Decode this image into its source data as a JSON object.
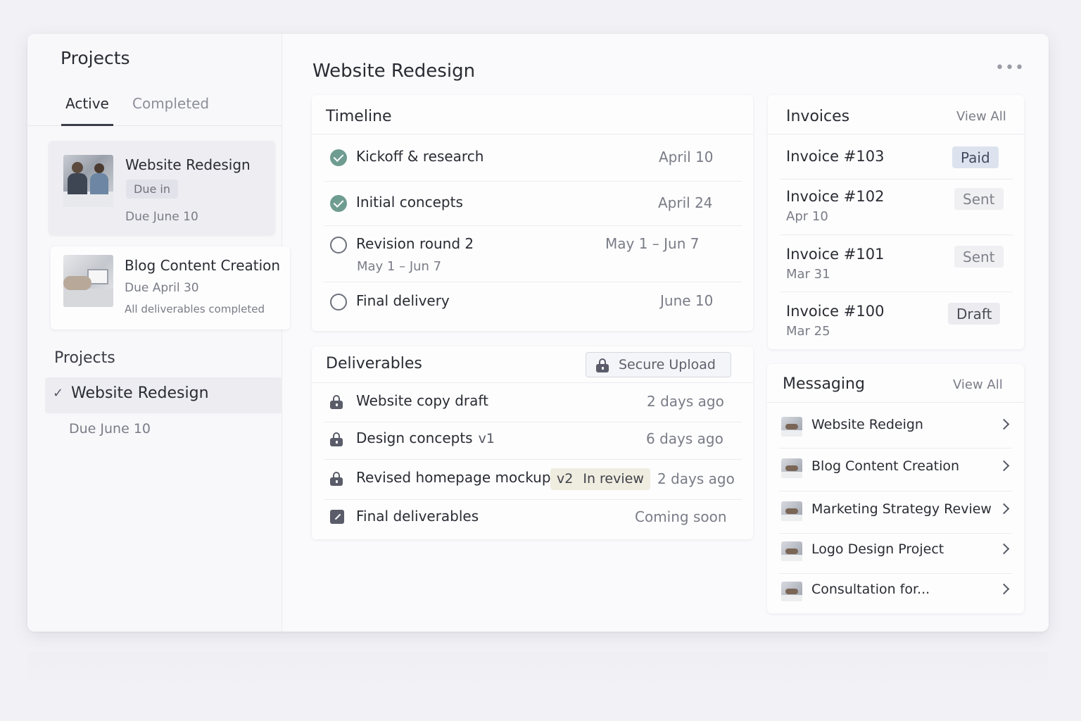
{
  "sidebar": {
    "title": "Projects",
    "tabs": [
      "Active",
      "Completed"
    ],
    "cards": [
      {
        "title": "Website Redesign",
        "chip": "Due in",
        "due": "Due June 10"
      },
      {
        "title": "Blog Content Creation",
        "due": "Due April 30",
        "note": "All deliverables completed"
      }
    ],
    "projects_heading": "Projects",
    "selected_project": "Website Redesign",
    "selected_due": "Due June 10"
  },
  "main": {
    "title": "Website Redesign",
    "more": "•••"
  },
  "timeline": {
    "heading": "Timeline",
    "items": [
      {
        "label": "Kickoff & research",
        "date": "April 10",
        "status": "done"
      },
      {
        "label": "Initial concepts",
        "date": "April 24",
        "status": "done"
      },
      {
        "label": "Revision round 2",
        "date": "May 1 – Jun 7",
        "sub": "May 1 – Jun 7",
        "status": "open"
      },
      {
        "label": "Final delivery",
        "date": "June 10",
        "status": "open"
      }
    ]
  },
  "deliverables": {
    "heading": "Deliverables",
    "upload_label": "Secure Upload",
    "items": [
      {
        "label": "Website copy draft",
        "when": "2 days ago"
      },
      {
        "label": "Design concepts",
        "version": "v1",
        "when": "6 days ago"
      },
      {
        "label": "Revised homepage mockup",
        "version": "v2",
        "status": "In review",
        "when": "2 days ago"
      },
      {
        "label": "Final deliverables",
        "when": "Coming soon"
      }
    ]
  },
  "invoices": {
    "heading": "Invoices",
    "view_all": "View All",
    "items": [
      {
        "number": "Invoice #103",
        "status": "Paid"
      },
      {
        "number": "Invoice #102",
        "date": "Apr 10",
        "status": "Sent"
      },
      {
        "number": "Invoice #101",
        "date": "Mar 31",
        "status": "Sent"
      },
      {
        "number": "Invoice #100",
        "date": "Mar 25",
        "status": "Draft"
      }
    ]
  },
  "messaging": {
    "heading": "Messaging",
    "view_all": "View All",
    "threads": [
      "Website Redeign",
      "Blog Content Creation",
      "Marketing Strategy Review",
      "Logo Design Project",
      "Consultation for..."
    ]
  },
  "colors": {
    "background": "#f2f2f6",
    "done_check": "#6f9c90",
    "paid_badge": "#dde3ee",
    "review_chip": "#efece0"
  }
}
